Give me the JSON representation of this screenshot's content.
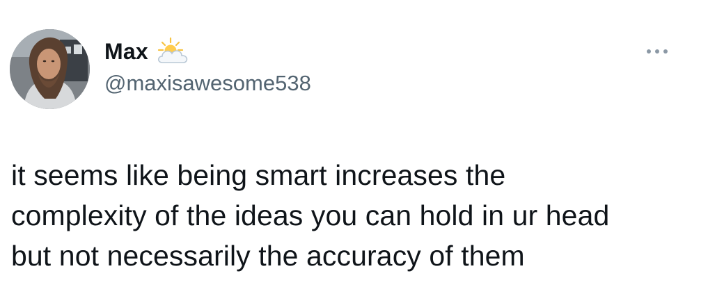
{
  "tweet": {
    "author": {
      "display_name": "Max",
      "badge_icon": "sun-behind-cloud-icon",
      "handle": "@maxisawesome538",
      "avatar_icon": "profile-photo"
    },
    "text_lines": [
      "it seems like being smart increases the",
      "complexity of the ideas you can hold in ur head",
      "but not necessarily the accuracy of them"
    ],
    "more_icon": "more-options-icon"
  },
  "colors": {
    "text": "#0f1419",
    "secondary_text": "#536471",
    "dots": "#8b98a5",
    "background": "#ffffff"
  }
}
